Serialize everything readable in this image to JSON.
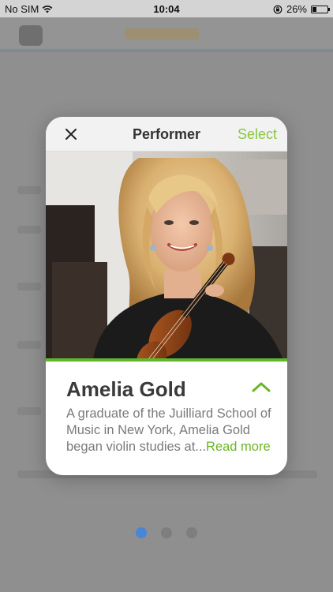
{
  "status_bar": {
    "carrier": "No SIM",
    "time": "10:04",
    "battery_percent": "26%",
    "battery_level": 0.26,
    "icons": [
      "wifi-icon",
      "rotation-lock-icon",
      "battery-icon"
    ]
  },
  "modal": {
    "close_icon": "close-icon",
    "title": "Performer",
    "select_label": "Select",
    "accent_color": "#8cc63f",
    "performer": {
      "name": "Amelia Gold",
      "bio": "A graduate of the Juilliard School of Music in New York, Amelia Gold began violin studies at...",
      "read_more_label": "Read more",
      "photo_icon": "performer-photo"
    },
    "collapse_icon": "chevron-up-icon"
  },
  "pager": {
    "dots": 3,
    "active_index": 0,
    "active_color": "#4a86d6"
  }
}
